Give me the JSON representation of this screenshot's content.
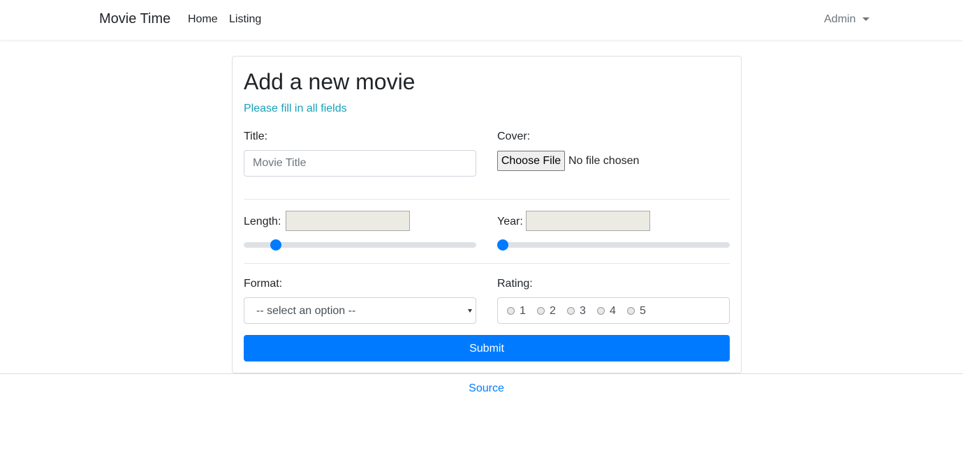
{
  "navbar": {
    "brand": "Movie Time",
    "links": [
      {
        "label": "Home"
      },
      {
        "label": "Listing"
      }
    ],
    "user_menu": {
      "label": "Admin"
    }
  },
  "form": {
    "title": "Add a new movie",
    "subtitle": "Please fill in all fields",
    "title_field": {
      "label": "Title:",
      "placeholder": "Movie Title",
      "value": ""
    },
    "cover_field": {
      "label": "Cover:",
      "button_label": "Choose File",
      "status": "No file chosen"
    },
    "length_field": {
      "label": "Length:",
      "value": "",
      "slider_fraction": 0.12
    },
    "year_field": {
      "label": "Year:",
      "value": "",
      "slider_fraction": 0.0
    },
    "format_field": {
      "label": "Format:",
      "selected": "-- select an option --"
    },
    "rating_field": {
      "label": "Rating:",
      "options": [
        "1",
        "2",
        "3",
        "4",
        "5"
      ]
    },
    "submit_label": "Submit"
  },
  "footer": {
    "link_label": "Source"
  },
  "colors": {
    "primary": "#007bff",
    "subtitle": "#17a2b8",
    "muted": "#6c757d"
  }
}
